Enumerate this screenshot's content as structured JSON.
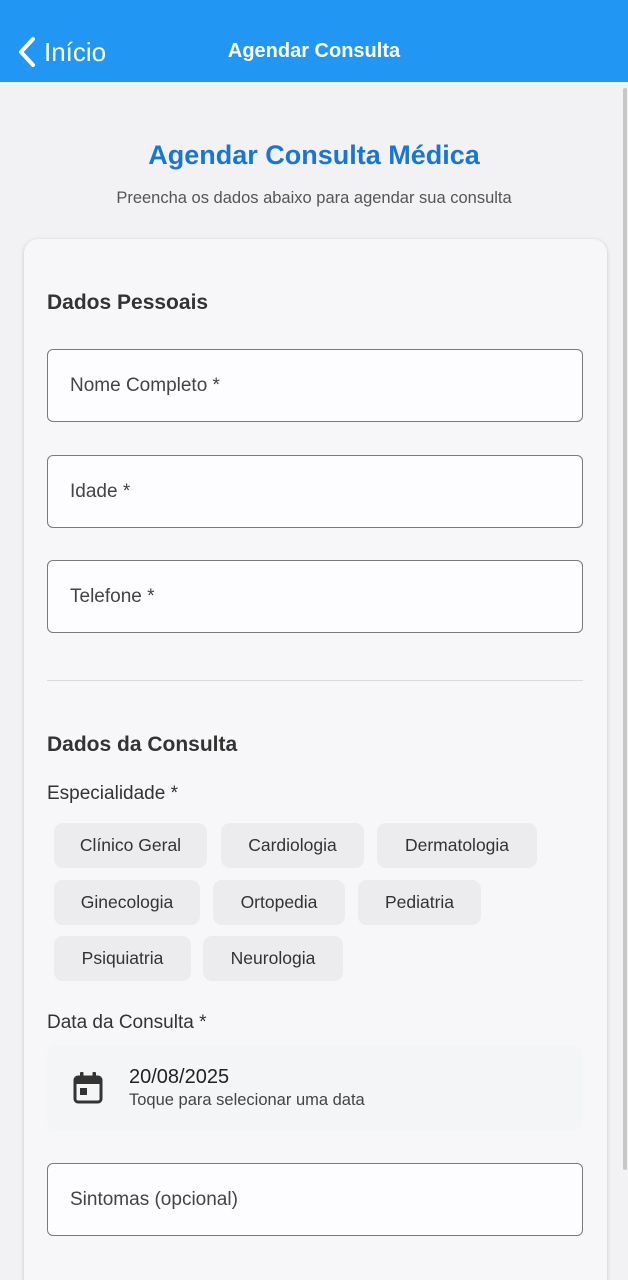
{
  "navbar": {
    "back_label": "Início",
    "title": "Agendar Consulta",
    "color": "#2196f3"
  },
  "header": {
    "title": "Agendar Consulta Médica",
    "subtitle": "Preencha os dados abaixo para agendar sua consulta"
  },
  "personal": {
    "section_title": "Dados Pessoais",
    "name_placeholder": "Nome Completo *",
    "age_placeholder": "Idade *",
    "phone_placeholder": "Telefone *"
  },
  "appointment": {
    "section_title": "Dados da Consulta",
    "specialty_label": "Especialidade *",
    "specialties": [
      "Clínico Geral",
      "Cardiologia",
      "Dermatologia",
      "Ginecologia",
      "Ortopedia",
      "Pediatria",
      "Psiquiatria",
      "Neurologia"
    ],
    "date_label": "Data da Consulta *",
    "date_value": "20/08/2025",
    "date_hint": "Toque para selecionar uma data",
    "date_icon": "calendar-icon",
    "symptoms_placeholder": "Sintomas (opcional)"
  }
}
